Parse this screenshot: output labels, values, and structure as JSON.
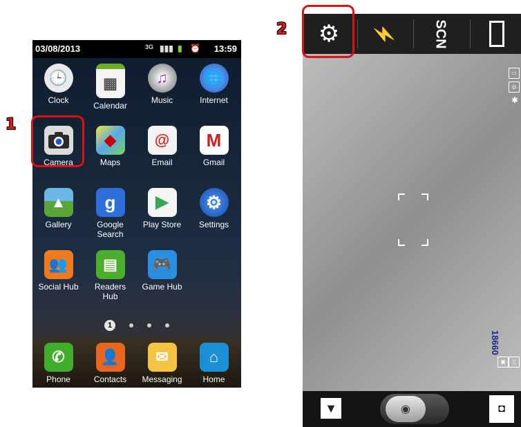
{
  "annotations": {
    "step1": "1",
    "step2": "2"
  },
  "status_bar": {
    "date": "03/08/2013",
    "time": "13:59",
    "network": "3G"
  },
  "apps": [
    {
      "label": "Clock",
      "icon": "clock-icon"
    },
    {
      "label": "Calendar",
      "icon": "calendar-icon"
    },
    {
      "label": "Music",
      "icon": "music-icon"
    },
    {
      "label": "Internet",
      "icon": "globe-icon"
    },
    {
      "label": "Camera",
      "icon": "camera-icon"
    },
    {
      "label": "Maps",
      "icon": "maps-icon"
    },
    {
      "label": "Email",
      "icon": "email-icon"
    },
    {
      "label": "Gmail",
      "icon": "gmail-icon"
    },
    {
      "label": "Gallery",
      "icon": "gallery-icon"
    },
    {
      "label": "Google\nSearch",
      "icon": "google-search-icon"
    },
    {
      "label": "Play Store",
      "icon": "play-store-icon"
    },
    {
      "label": "Settings",
      "icon": "gear-icon"
    },
    {
      "label": "Social Hub",
      "icon": "social-hub-icon"
    },
    {
      "label": "Readers\nHub",
      "icon": "readers-hub-icon"
    },
    {
      "label": "Game Hub",
      "icon": "gamepad-icon"
    }
  ],
  "page_indicator": {
    "current": "1"
  },
  "dock": [
    {
      "label": "Phone",
      "icon": "phone-icon"
    },
    {
      "label": "Contacts",
      "icon": "contacts-icon"
    },
    {
      "label": "Messaging",
      "icon": "envelope-icon"
    },
    {
      "label": "Home",
      "icon": "home-icon"
    }
  ],
  "camera": {
    "shots_remaining": "18660",
    "toolbar": [
      "gear-icon",
      "flash-off-icon",
      "scene-icon",
      "view-mode-icon"
    ]
  },
  "colors": {
    "annotation": "#e01010",
    "counter": "#1a2a8a"
  }
}
